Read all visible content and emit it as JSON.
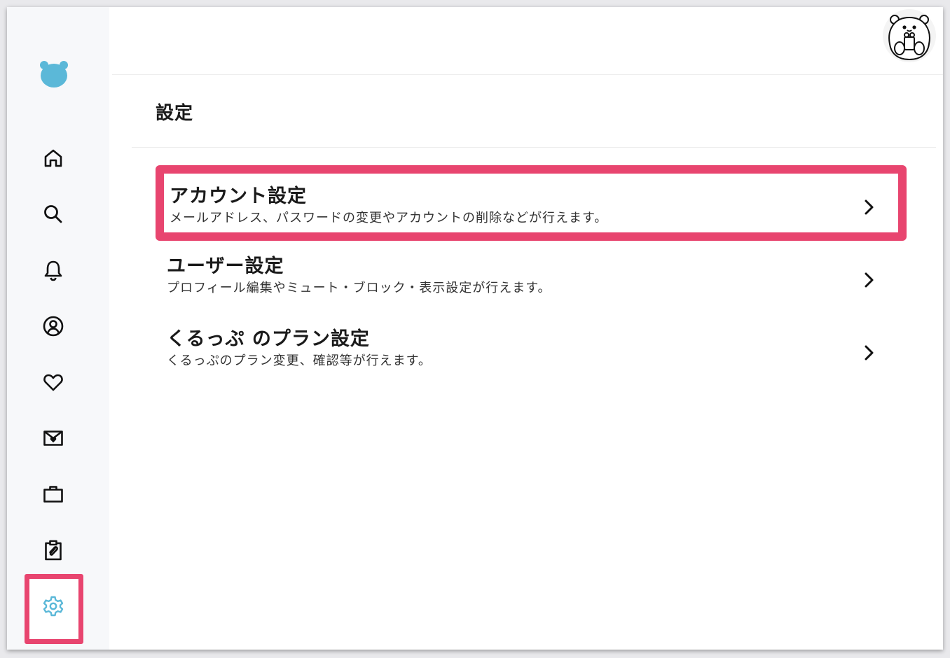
{
  "page": {
    "title": "設定"
  },
  "sidebar": {
    "logo_icon": "bear-logo-icon",
    "items": [
      {
        "id": "home",
        "icon": "home-icon"
      },
      {
        "id": "search",
        "icon": "search-icon"
      },
      {
        "id": "notifications",
        "icon": "bell-icon"
      },
      {
        "id": "profile",
        "icon": "user-circle-icon"
      },
      {
        "id": "favorites",
        "icon": "heart-icon"
      },
      {
        "id": "messages",
        "icon": "envelope-heart-icon"
      },
      {
        "id": "jobs",
        "icon": "briefcase-icon"
      },
      {
        "id": "applications",
        "icon": "clipboard-clip-icon"
      },
      {
        "id": "settings",
        "icon": "gear-icon",
        "active": true
      }
    ]
  },
  "header": {
    "avatar_icon": "bear-avatar-icon"
  },
  "settings": [
    {
      "title": "アカウント設定",
      "description": "メールアドレス、パスワードの変更やアカウントの削除などが行えます。",
      "highlighted": true
    },
    {
      "title": "ユーザー設定",
      "description": "プロフィール編集やミュート・ブロック・表示設定が行えます。",
      "highlighted": false
    },
    {
      "title": "くるっぷ のプラン設定",
      "description": "くるっぷのプラン変更、確認等が行えます。",
      "highlighted": false
    }
  ],
  "colors": {
    "accent": "#e8456f",
    "brand": "#5bb8d8",
    "active_icon": "#5bb8d8"
  }
}
